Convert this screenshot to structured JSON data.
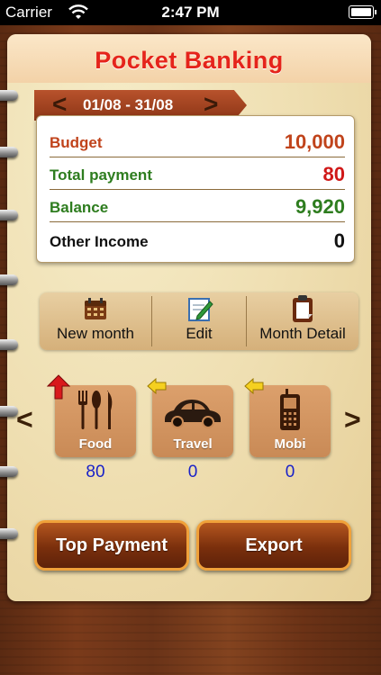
{
  "status_bar": {
    "carrier": "Carrier",
    "time": "2:47 PM"
  },
  "app": {
    "title": "Pocket Banking"
  },
  "period": {
    "range": "01/08 - 31/08",
    "prev": "<",
    "next": ">"
  },
  "summary": {
    "budget": {
      "label": "Budget",
      "value": "10,000",
      "label_color": "#c0431b",
      "value_color": "#c0431b"
    },
    "total_payment": {
      "label": "Total payment",
      "value": "80",
      "label_color": "#2e7d1f",
      "value_color": "#d01818"
    },
    "balance": {
      "label": "Balance",
      "value": "9,920",
      "label_color": "#2e7d1f",
      "value_color": "#2e7d1f"
    },
    "other_income": {
      "label": "Other Income",
      "value": "0",
      "label_color": "#111111",
      "value_color": "#111111"
    }
  },
  "toolbar": {
    "new_month": {
      "label": "New month",
      "icon": "calendar-icon"
    },
    "edit": {
      "label": "Edit",
      "icon": "edit-pencil-icon"
    },
    "month_detail": {
      "label": "Month Detail",
      "icon": "clipboard-icon"
    }
  },
  "categories": {
    "prev": "<",
    "next": ">",
    "items": [
      {
        "name": "Food",
        "amount": "80",
        "icon": "fork-knife-icon",
        "badge": "up-arrow-red-icon"
      },
      {
        "name": "Travel",
        "amount": "0",
        "icon": "car-icon",
        "badge": "left-arrow-yellow-icon"
      },
      {
        "name": "Mobi",
        "amount": "0",
        "icon": "mobile-phone-icon",
        "badge": "left-arrow-yellow-icon"
      }
    ]
  },
  "actions": {
    "top_payment": "Top Payment",
    "export": "Export"
  }
}
